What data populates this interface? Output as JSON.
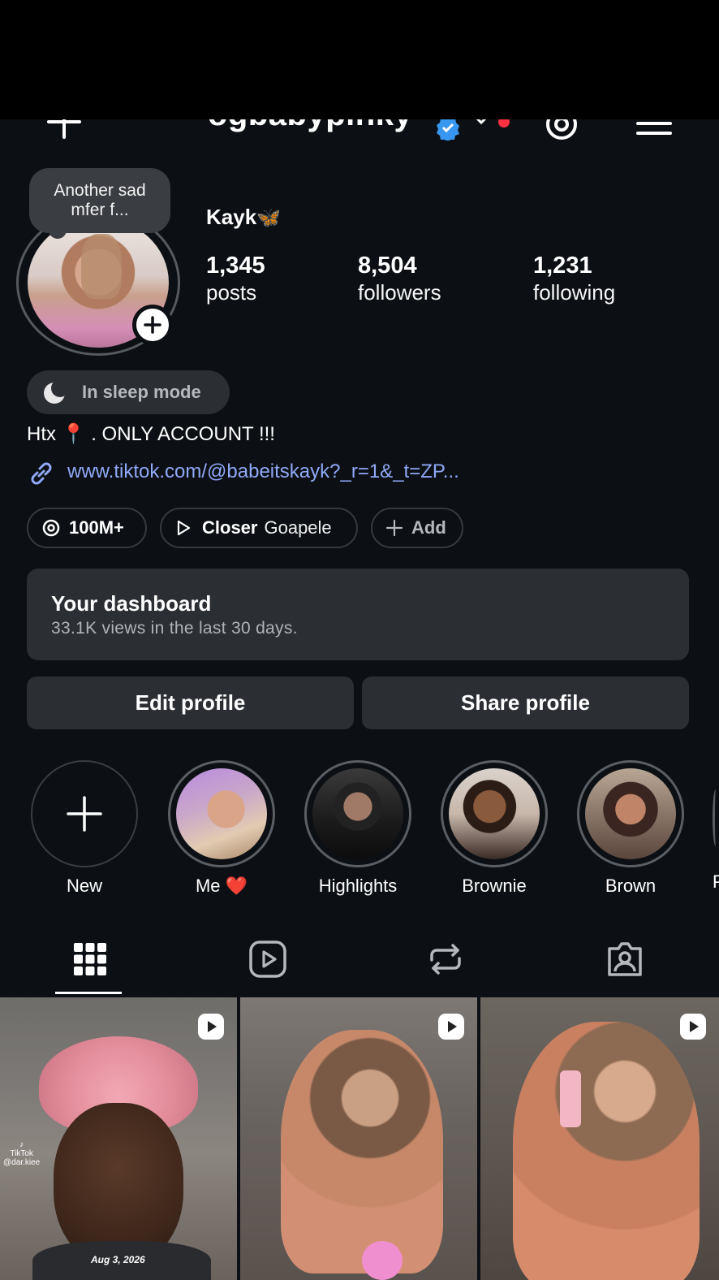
{
  "header": {
    "username": "ogbabypinky",
    "icons": [
      "plus-icon",
      "verified-badge-icon",
      "chevron-down-icon",
      "threads-icon",
      "menu-icon"
    ]
  },
  "note": {
    "text": "Another sad mfer f..."
  },
  "profile": {
    "display_name": "Kayk",
    "display_name_emoji": "🦋",
    "stats": [
      {
        "value": "1,345",
        "label": "posts"
      },
      {
        "value": "8,504",
        "label": "followers"
      },
      {
        "value": "1,231",
        "label": "following"
      }
    ]
  },
  "status": {
    "label": "In sleep mode"
  },
  "bio": {
    "text": "Htx 📍 . ONLY ACCOUNT !!!"
  },
  "link": {
    "text": "www.tiktok.com/@babeitskayk?_r=1&_t=ZP..."
  },
  "pills": {
    "threads": "100M+",
    "music_title": "Closer",
    "music_artist": "Goapele",
    "add": "Add"
  },
  "dashboard": {
    "title": "Your dashboard",
    "subtitle": "33.1K views in the last 30 days."
  },
  "buttons": {
    "edit": "Edit profile",
    "share": "Share profile"
  },
  "highlights": [
    {
      "label": "New"
    },
    {
      "label": "Me ❤️"
    },
    {
      "label": "Highlights"
    },
    {
      "label": "Brownie"
    },
    {
      "label": "Brown"
    },
    {
      "label": "P"
    }
  ],
  "tabs": [
    "grid-icon",
    "reels-icon",
    "reposts-icon",
    "tagged-icon"
  ],
  "posts": [
    {
      "watermark": "TikTok\n@dar.kiee",
      "date": "Aug 3, 2026"
    },
    {
      "date": ""
    },
    {
      "date": ""
    }
  ],
  "colors": {
    "background": "#0c1014",
    "surface": "#2b2e33",
    "link": "#8fa8f7",
    "notification": "#ff3040",
    "verified": "#3897f0"
  }
}
